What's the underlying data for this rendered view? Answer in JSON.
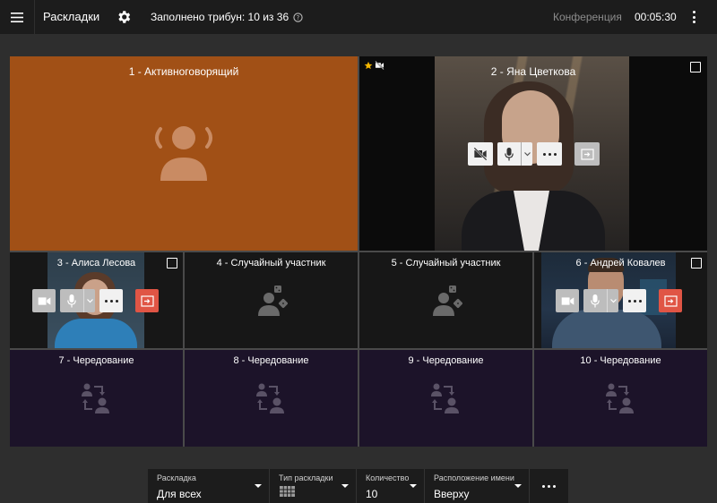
{
  "topbar": {
    "title": "Раскладки",
    "filled_text": "Заполнено трибун: 10 из 36",
    "conference_label": "Конференция",
    "timer": "00:05:30"
  },
  "tiles": [
    {
      "label": "1 - Активноговорящий"
    },
    {
      "label": "2 - Яна Цветкова"
    },
    {
      "label": "3 - Алиса Лесова"
    },
    {
      "label": "4 - Случайный участник"
    },
    {
      "label": "5 - Случайный участник"
    },
    {
      "label": "6 - Андрей Ковалев"
    },
    {
      "label": "7 - Чередование"
    },
    {
      "label": "8 - Чередование"
    },
    {
      "label": "9 - Чередование"
    },
    {
      "label": "10 - Чередование"
    }
  ],
  "bottom": {
    "layout": {
      "label": "Раскладка",
      "value": "Для всех"
    },
    "layout_type": {
      "label": "Тип раскладки"
    },
    "count": {
      "label": "Количество",
      "value": "10"
    },
    "name_position": {
      "label": "Расположение имени",
      "value": "Вверху"
    }
  },
  "colors": {
    "active_speaker_bg": "#a15016",
    "rotation_bg": "#1c1329",
    "random_bg": "#171717",
    "leave_button": "#e05545"
  }
}
